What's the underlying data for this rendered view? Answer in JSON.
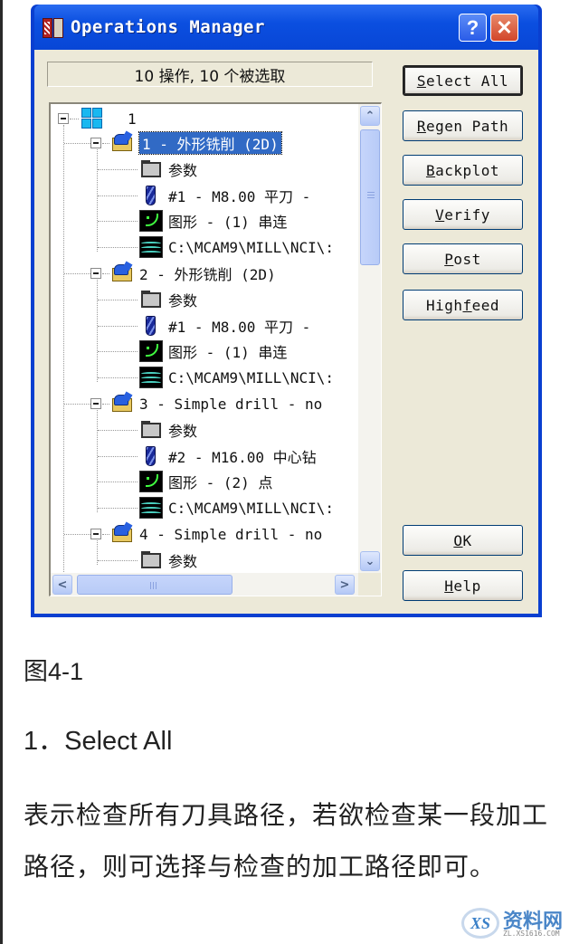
{
  "window": {
    "title": "Operations Manager",
    "help_glyph": "?",
    "close_glyph": "✕"
  },
  "status": "10 操作, 10 个被选取",
  "tree": {
    "root_label": "1",
    "operations": [
      {
        "label": "1 - 外形铣削 (2D)",
        "selected": true,
        "children": [
          {
            "icon": "folder-icon",
            "label": "参数"
          },
          {
            "icon": "tool-icon",
            "label": "#1 - M8.00 平刀 -"
          },
          {
            "icon": "geometry-icon",
            "label": "图形 - (1) 串连"
          },
          {
            "icon": "nci-icon",
            "label": "C:\\MCAM9\\MILL\\NCI\\:"
          }
        ]
      },
      {
        "label": "2 - 外形铣削 (2D)",
        "selected": false,
        "children": [
          {
            "icon": "folder-icon",
            "label": "参数"
          },
          {
            "icon": "tool-icon",
            "label": "#1 - M8.00 平刀 -"
          },
          {
            "icon": "geometry-icon",
            "label": "图形 - (1) 串连"
          },
          {
            "icon": "nci-icon",
            "label": "C:\\MCAM9\\MILL\\NCI\\:"
          }
        ]
      },
      {
        "label": "3 - Simple drill - no",
        "selected": false,
        "children": [
          {
            "icon": "folder-icon",
            "label": "参数"
          },
          {
            "icon": "tool-icon",
            "label": "#2 - M16.00 中心钻"
          },
          {
            "icon": "geometry-icon",
            "label": "图形 - (2) 点"
          },
          {
            "icon": "nci-icon",
            "label": "C:\\MCAM9\\MILL\\NCI\\:"
          }
        ]
      },
      {
        "label": "4 - Simple drill - no",
        "selected": false,
        "children": [
          {
            "icon": "folder-icon",
            "label": "参数"
          }
        ]
      }
    ]
  },
  "buttons": {
    "select_all": {
      "accel": "S",
      "rest": "elect All"
    },
    "regen_path": {
      "accel": "R",
      "rest": "egen Path"
    },
    "backplot": {
      "accel": "B",
      "rest": "ackplot"
    },
    "verify": {
      "accel": "V",
      "rest": "erify"
    },
    "post": {
      "accel": "P",
      "rest": "ost"
    },
    "highfeed": {
      "pre": "High",
      "accel": "f",
      "rest": "eed"
    },
    "ok": {
      "accel": "O",
      "rest": "K"
    },
    "help": {
      "accel": "H",
      "rest": "elp"
    }
  },
  "scroll": {
    "up": "⌃",
    "down": "⌄",
    "left": "<",
    "right": ">"
  },
  "doc": {
    "caption": "图4-1",
    "heading": "1．Select All",
    "paragraph": "表示检查所有刀具路径，若欲检查某一段加工路径，则可选择与检查的加工路径即可。"
  },
  "watermark": {
    "logo": "XS",
    "name": "资料网",
    "url": "ZL.XS1616.COM"
  },
  "colors": {
    "titlebar": "#0b4fe0",
    "selection": "#316ac5",
    "dialog_bg": "#ece9d8"
  }
}
